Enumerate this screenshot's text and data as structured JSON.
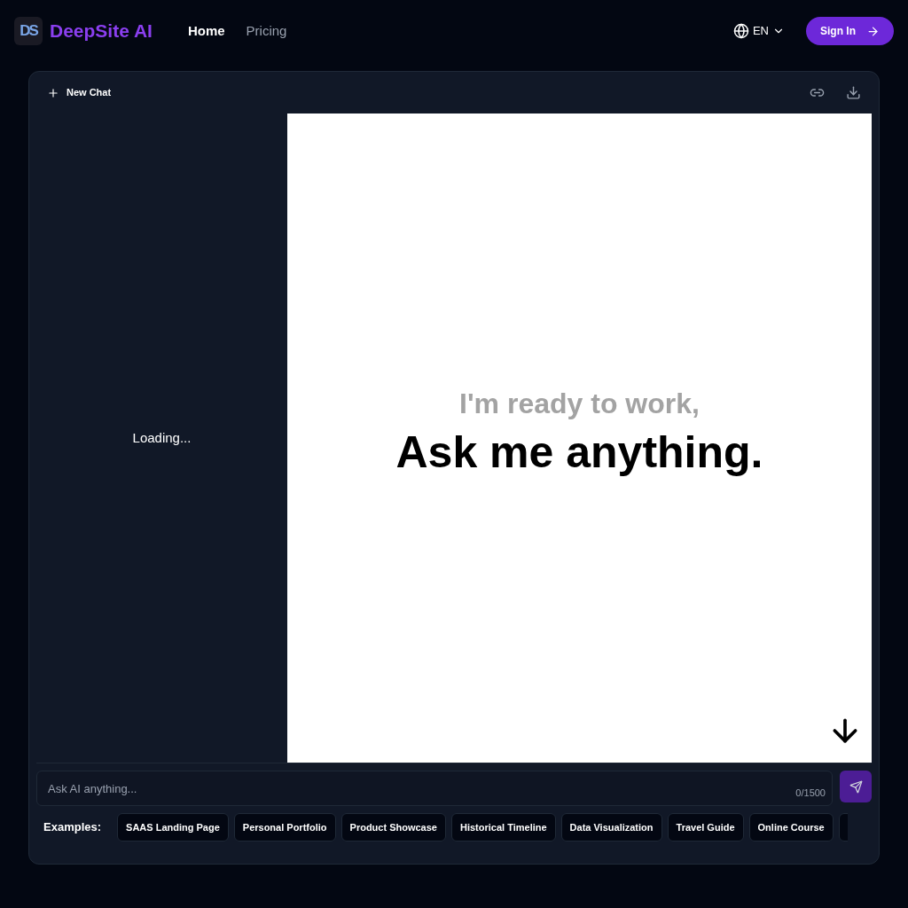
{
  "header": {
    "logo_mark": "DS",
    "brand": "DeepSite AI",
    "nav": [
      {
        "label": "Home",
        "selected": true
      },
      {
        "label": "Pricing",
        "selected": false
      }
    ],
    "language": "EN",
    "sign_in": "Sign In"
  },
  "editor": {
    "new_chat": "New Chat",
    "sidebar_status": "Loading...",
    "preview": {
      "subtitle": "I'm ready to work,",
      "title": "Ask me anything."
    },
    "prompt": {
      "placeholder": "Ask AI anything...",
      "counter": "0/1500"
    },
    "examples_label": "Examples:",
    "examples": [
      "SAAS Landing Page",
      "Personal Portfolio",
      "Product Showcase",
      "Historical Timeline",
      "Data Visualization",
      "Travel Guide",
      "Online Course"
    ]
  }
}
